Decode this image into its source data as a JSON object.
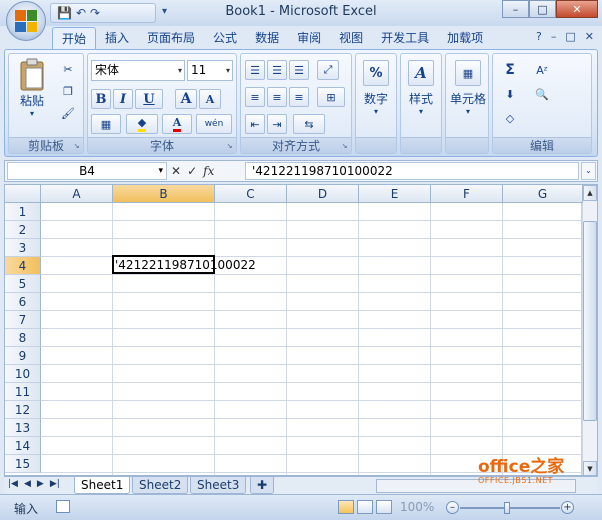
{
  "window": {
    "title": "Book1 - Microsoft Excel",
    "controls": {
      "minimize": "–",
      "maximize": "□",
      "close": "✕"
    }
  },
  "quick_access": {
    "save_icon": "💾",
    "undo_icon": "↶",
    "redo_icon": "↷",
    "more": "▾"
  },
  "tabs": [
    {
      "label": "开始",
      "active": true
    },
    {
      "label": "插入",
      "active": false
    },
    {
      "label": "页面布局",
      "active": false
    },
    {
      "label": "公式",
      "active": false
    },
    {
      "label": "数据",
      "active": false
    },
    {
      "label": "审阅",
      "active": false
    },
    {
      "label": "视图",
      "active": false
    },
    {
      "label": "开发工具",
      "active": false
    },
    {
      "label": "加载项",
      "active": false
    }
  ],
  "tab_icons": {
    "help": "?",
    "min": "–",
    "restore": "□",
    "close": "✕"
  },
  "ribbon": {
    "clipboard": {
      "label": "剪贴板",
      "paste": "粘贴"
    },
    "font": {
      "label": "字体",
      "font_name": "宋体",
      "font_size": "11",
      "bold": "B",
      "italic": "I",
      "underline": "U",
      "grow": "A",
      "shrink": "A",
      "font_color": "A",
      "wen": "wén"
    },
    "alignment": {
      "label": "对齐方式"
    },
    "number": {
      "label": "数字",
      "button": "数字",
      "symbol": "%"
    },
    "styles": {
      "label": "样式",
      "button": "样式"
    },
    "cells": {
      "label": "单元格",
      "button": "单元格"
    },
    "editing": {
      "label": "编辑",
      "sum": "Σ"
    }
  },
  "formula_bar": {
    "name_box": "B4",
    "fx": "fx",
    "cancel": "✕",
    "enter": "✓",
    "content": "'421221198710100022"
  },
  "grid": {
    "columns": [
      "A",
      "B",
      "C",
      "D",
      "E",
      "F",
      "G"
    ],
    "selected_column": "B",
    "rows": [
      "1",
      "2",
      "3",
      "4",
      "5",
      "6",
      "7",
      "8",
      "9",
      "10",
      "11",
      "12",
      "13",
      "14",
      "15"
    ],
    "selected_row": "4",
    "active_cell": "B4",
    "active_cell_value": "'421221198710100022"
  },
  "sheet_tabs": [
    {
      "label": "Sheet1",
      "active": true
    },
    {
      "label": "Sheet2",
      "active": false
    },
    {
      "label": "Sheet3",
      "active": false
    }
  ],
  "watermark": {
    "main": "office之家",
    "sub": "OFFICE.JB51.NET"
  },
  "status_bar": {
    "mode": "输入",
    "zoom": "100%"
  }
}
